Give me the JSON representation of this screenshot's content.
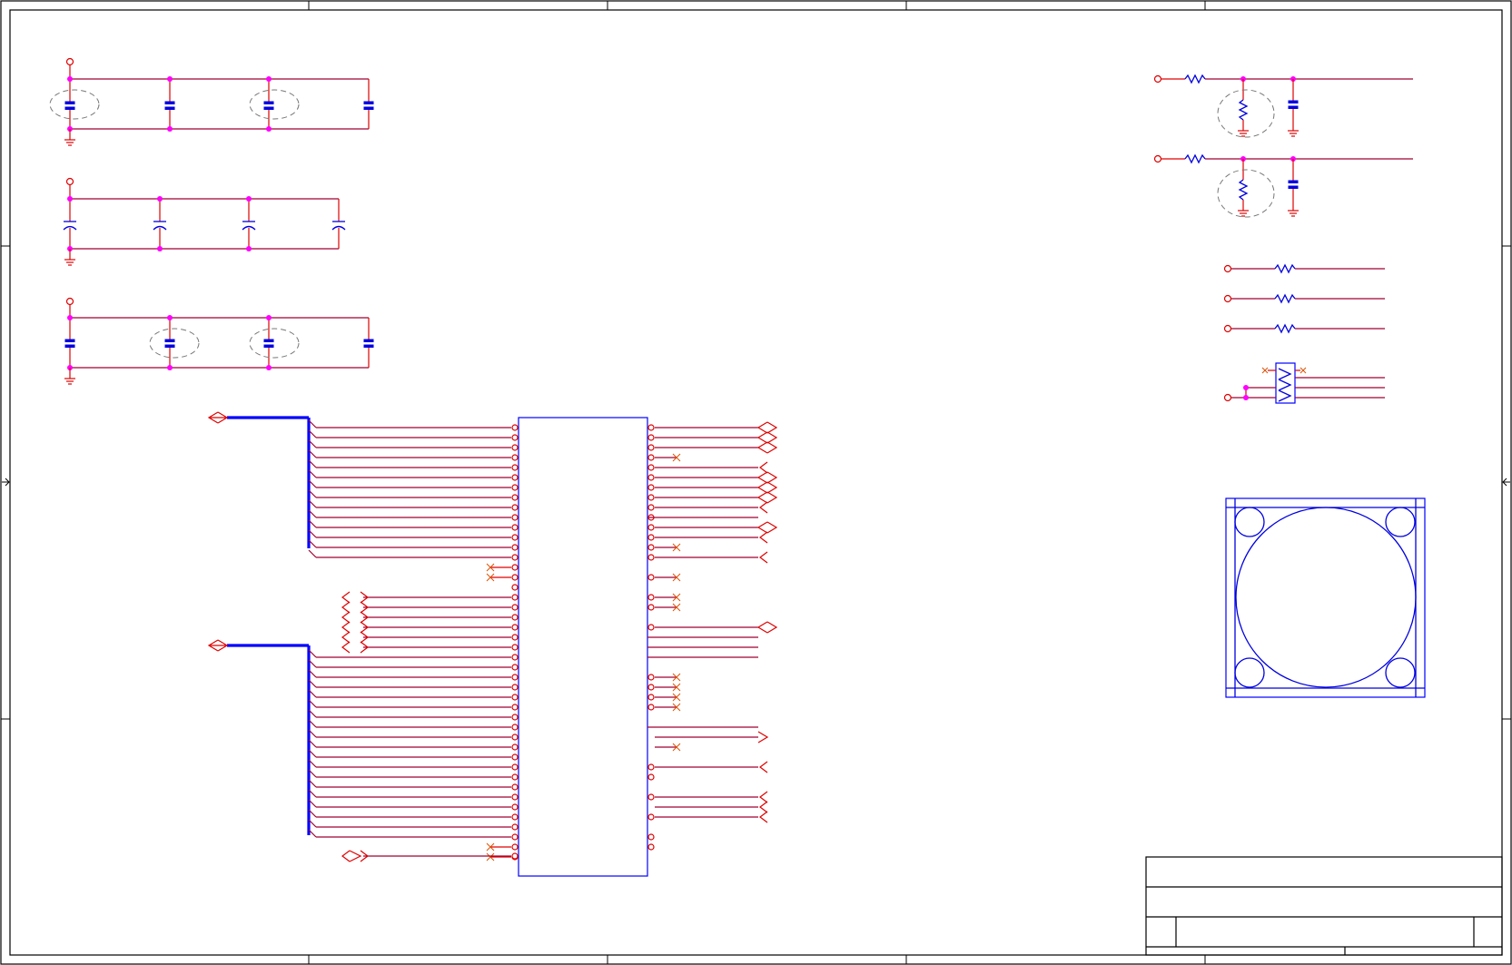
{
  "sheet": {
    "zone_columns": 5,
    "zone_rows": 4
  },
  "decoupling_banks": [
    {
      "caps": 4,
      "style": "ceramic",
      "highlighted": [
        0,
        2
      ]
    },
    {
      "caps": 4,
      "style": "electrolytic",
      "highlighted": []
    },
    {
      "caps": 4,
      "style": "ceramic",
      "highlighted": [
        1,
        2
      ]
    }
  ],
  "ic": {
    "left_pins": 44,
    "right_pins": 44
  },
  "rc_filters": 2,
  "series_resistors": 3,
  "resistor_array": 1,
  "mounting_footprint": {
    "shape": "square-with-circle",
    "corner_holes": 4
  },
  "title_block": {
    "rows": 3
  }
}
